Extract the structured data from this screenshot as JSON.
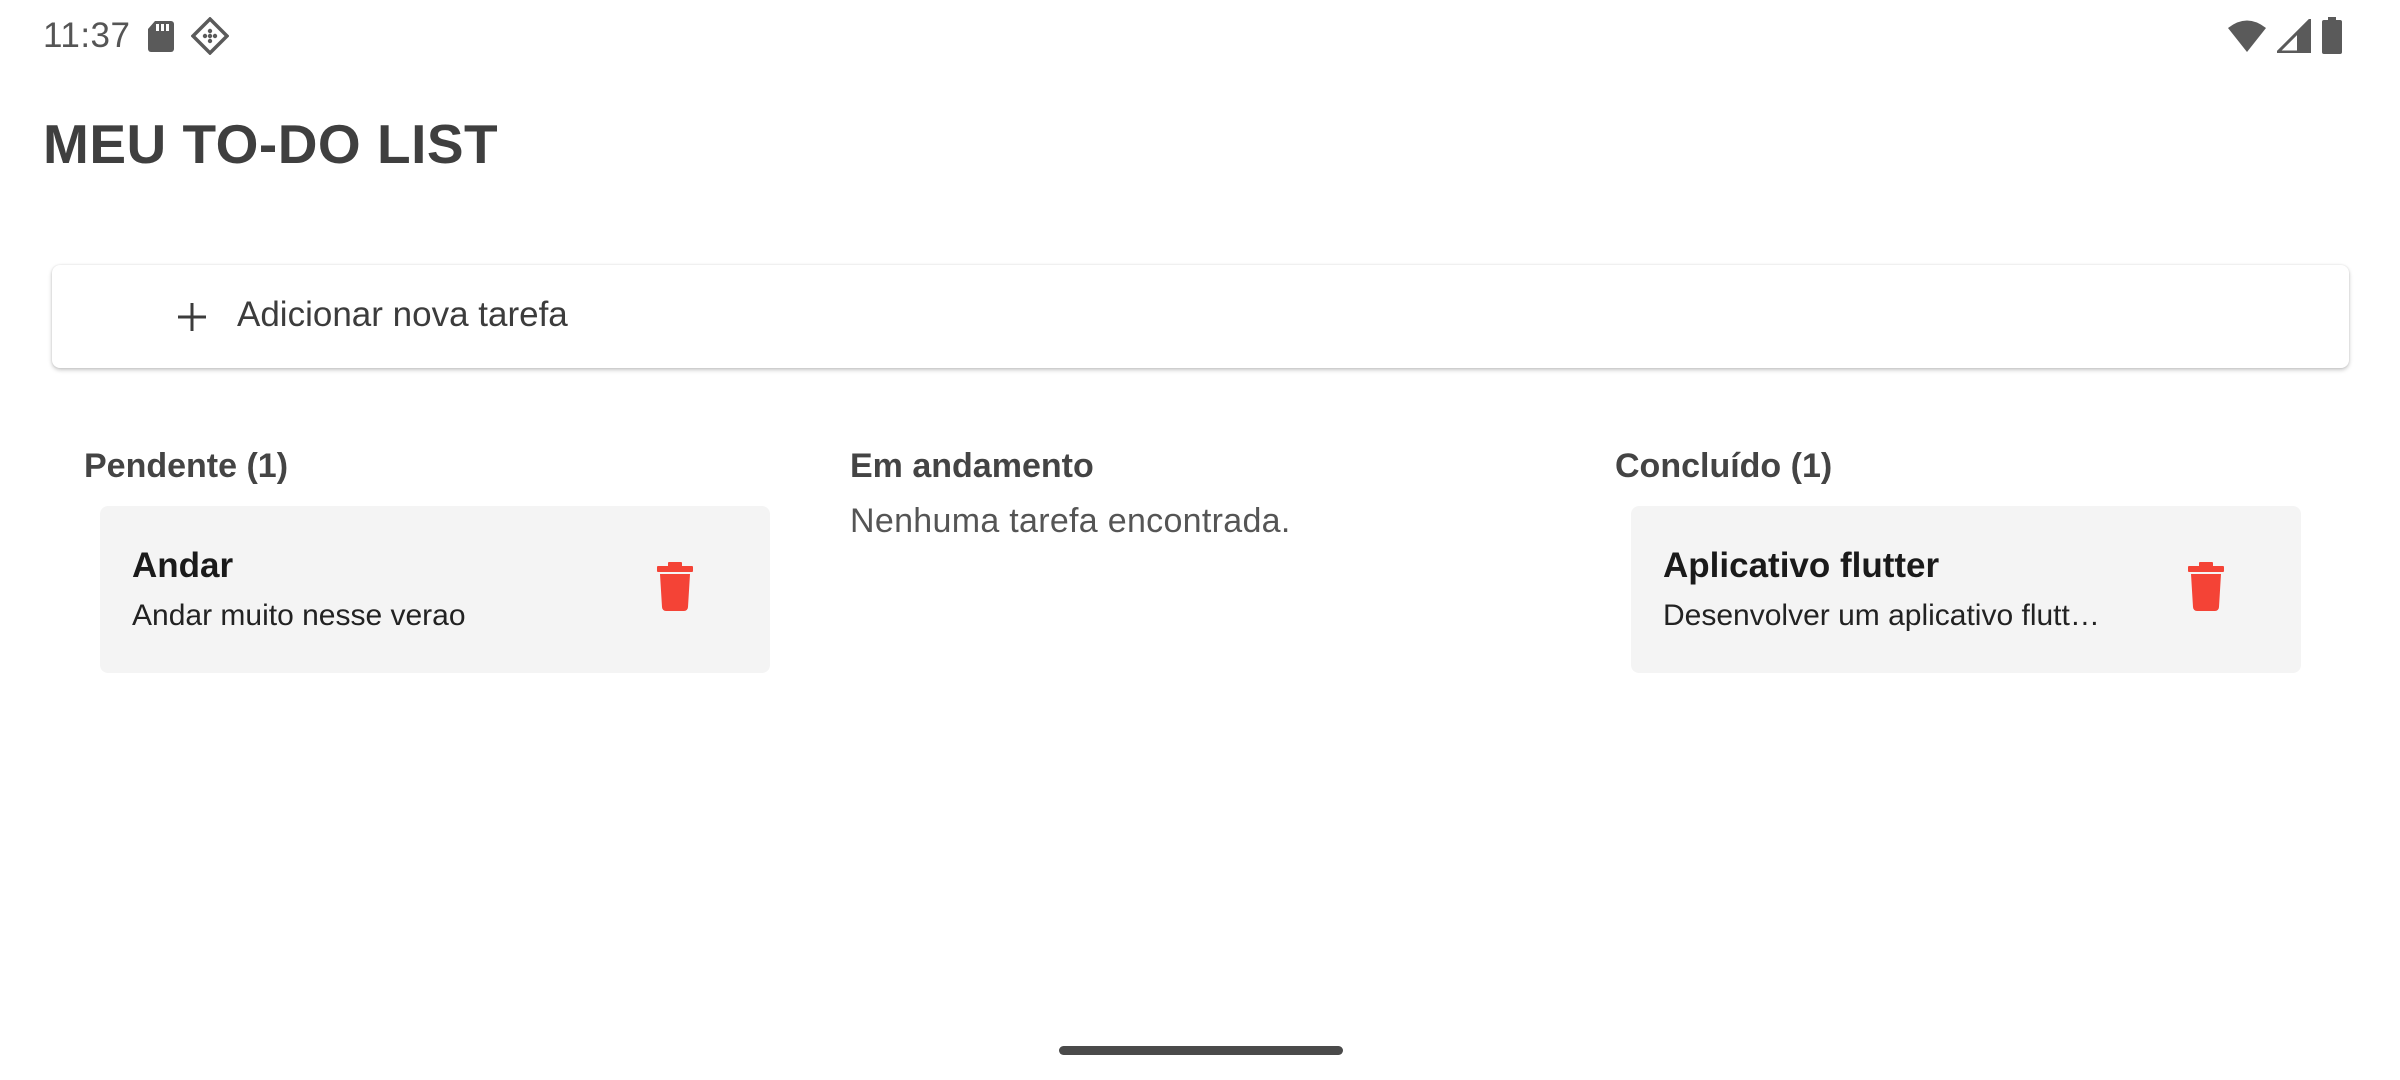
{
  "status_bar": {
    "time": "11:37",
    "icons": [
      "sd-card-icon",
      "app-notification-icon",
      "wifi-icon",
      "cell-signal-icon",
      "battery-icon"
    ]
  },
  "app": {
    "title": "MEU TO-DO LIST"
  },
  "add_task": {
    "icon": "plus-icon",
    "label": "Adicionar nova tarefa"
  },
  "columns": [
    {
      "id": "pending",
      "header": "Pendente (1)",
      "tasks": [
        {
          "title": "Andar",
          "description": "Andar muito nesse verao"
        }
      ]
    },
    {
      "id": "in_progress",
      "header": "Em andamento",
      "empty_text": "Nenhuma tarefa encontrada.",
      "tasks": []
    },
    {
      "id": "done",
      "header": "Concluído (1)",
      "tasks": [
        {
          "title": "Aplicativo flutter",
          "description": "Desenvolver um aplicativo flutt…"
        }
      ]
    }
  ],
  "colors": {
    "delete_icon": "#f44336",
    "card_background": "#f4f4f4",
    "text_primary": "#3c3c3c"
  }
}
